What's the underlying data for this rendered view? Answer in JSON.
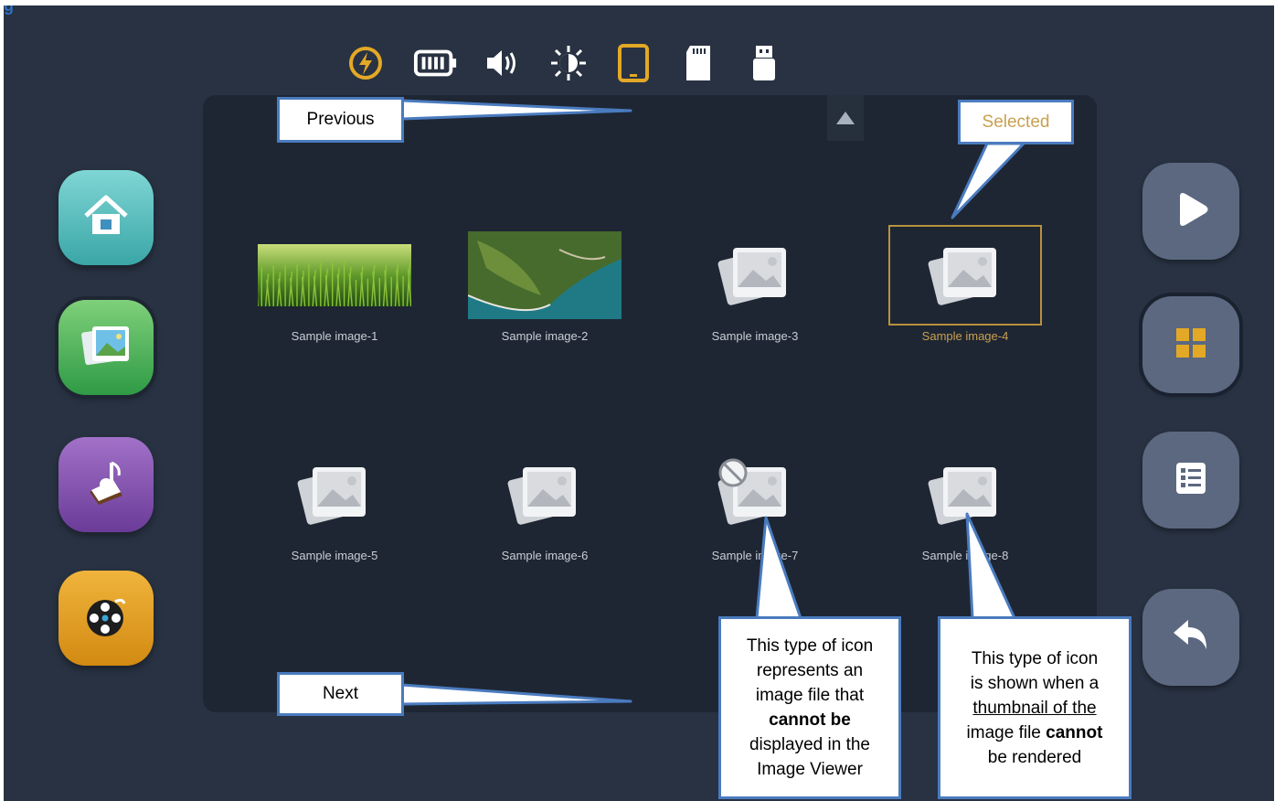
{
  "heading_fragment": "g",
  "status_bar": {
    "icons": [
      "power-icon",
      "battery-icon",
      "volume-icon",
      "brightness-icon",
      "tablet-icon",
      "sd-card-icon",
      "usb-drive-icon"
    ],
    "active_icon": "tablet-icon"
  },
  "left_apps": [
    "home-icon",
    "image-viewer-icon",
    "music-icon",
    "video-reel-icon"
  ],
  "right_controls": [
    "play-icon",
    "grid-view-icon",
    "list-view-icon",
    "back-icon"
  ],
  "tiles": [
    {
      "label": "Sample image-1",
      "kind": "grass-photo"
    },
    {
      "label": "Sample image-2",
      "kind": "aerial-photo"
    },
    {
      "label": "Sample image-3",
      "kind": "generic-image"
    },
    {
      "label": "Sample image-4",
      "kind": "generic-image",
      "selected": true
    },
    {
      "label": "Sample image-5",
      "kind": "generic-image"
    },
    {
      "label": "Sample image-6",
      "kind": "generic-image"
    },
    {
      "label": "Sample image-7",
      "kind": "unsupported-image"
    },
    {
      "label": "Sample image-8",
      "kind": "generic-image"
    }
  ],
  "callouts": {
    "previous": "Previous",
    "next": "Next",
    "selected": "Selected",
    "unsupported_lines": [
      "This type of icon",
      "represents an",
      "image file that",
      "cannot be",
      "displayed in the",
      "Image Viewer"
    ],
    "no_thumbnail_lines": [
      "This type of icon",
      "is shown when a",
      "thumbnail of the",
      "image file cannot",
      "be rendered"
    ]
  },
  "colors": {
    "background": "#283242",
    "panel": "#1e2633",
    "accent": "#e3a826",
    "selected_border": "#b8913e",
    "callout_border": "#4a7bbf"
  }
}
